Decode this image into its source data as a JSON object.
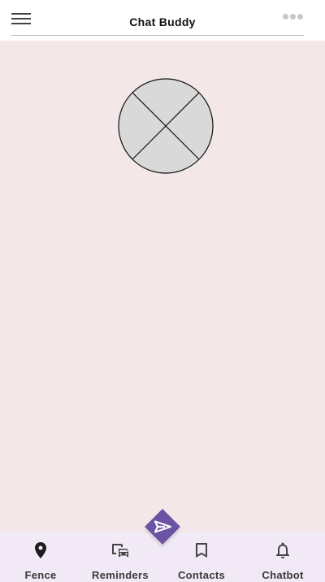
{
  "app": {
    "title": "Chat Buddy"
  },
  "header": {
    "menu_icon": "hamburger-menu-icon",
    "more_icon": "more-dots-icon"
  },
  "content": {
    "image_placeholder_icon": "broken-image-placeholder-icon"
  },
  "fab": {
    "icon": "send-icon",
    "color": "#6b52a3"
  },
  "bottom_nav": {
    "items": [
      {
        "label": "Fence",
        "icon": "location-pin-icon"
      },
      {
        "label": "Reminders",
        "icon": "vehicles-icon"
      },
      {
        "label": "Contacts",
        "icon": "bookmark-icon"
      },
      {
        "label": "Chatbot",
        "icon": "bell-icon"
      }
    ]
  },
  "colors": {
    "background": "#f3e8e7",
    "nav_background": "#f1e9f5",
    "accent": "#6b52a3"
  }
}
